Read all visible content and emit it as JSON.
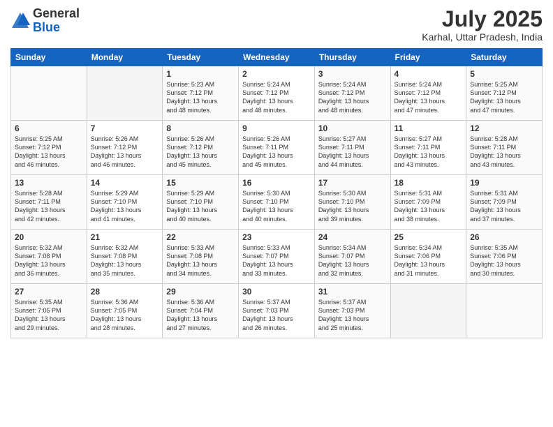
{
  "header": {
    "logo": {
      "general": "General",
      "blue": "Blue"
    },
    "title": "July 2025",
    "location": "Karhal, Uttar Pradesh, India"
  },
  "calendar": {
    "headers": [
      "Sunday",
      "Monday",
      "Tuesday",
      "Wednesday",
      "Thursday",
      "Friday",
      "Saturday"
    ],
    "weeks": [
      [
        {
          "day": "",
          "info": ""
        },
        {
          "day": "",
          "info": ""
        },
        {
          "day": "1",
          "info": "Sunrise: 5:23 AM\nSunset: 7:12 PM\nDaylight: 13 hours\nand 48 minutes."
        },
        {
          "day": "2",
          "info": "Sunrise: 5:24 AM\nSunset: 7:12 PM\nDaylight: 13 hours\nand 48 minutes."
        },
        {
          "day": "3",
          "info": "Sunrise: 5:24 AM\nSunset: 7:12 PM\nDaylight: 13 hours\nand 48 minutes."
        },
        {
          "day": "4",
          "info": "Sunrise: 5:24 AM\nSunset: 7:12 PM\nDaylight: 13 hours\nand 47 minutes."
        },
        {
          "day": "5",
          "info": "Sunrise: 5:25 AM\nSunset: 7:12 PM\nDaylight: 13 hours\nand 47 minutes."
        }
      ],
      [
        {
          "day": "6",
          "info": "Sunrise: 5:25 AM\nSunset: 7:12 PM\nDaylight: 13 hours\nand 46 minutes."
        },
        {
          "day": "7",
          "info": "Sunrise: 5:26 AM\nSunset: 7:12 PM\nDaylight: 13 hours\nand 46 minutes."
        },
        {
          "day": "8",
          "info": "Sunrise: 5:26 AM\nSunset: 7:12 PM\nDaylight: 13 hours\nand 45 minutes."
        },
        {
          "day": "9",
          "info": "Sunrise: 5:26 AM\nSunset: 7:11 PM\nDaylight: 13 hours\nand 45 minutes."
        },
        {
          "day": "10",
          "info": "Sunrise: 5:27 AM\nSunset: 7:11 PM\nDaylight: 13 hours\nand 44 minutes."
        },
        {
          "day": "11",
          "info": "Sunrise: 5:27 AM\nSunset: 7:11 PM\nDaylight: 13 hours\nand 43 minutes."
        },
        {
          "day": "12",
          "info": "Sunrise: 5:28 AM\nSunset: 7:11 PM\nDaylight: 13 hours\nand 43 minutes."
        }
      ],
      [
        {
          "day": "13",
          "info": "Sunrise: 5:28 AM\nSunset: 7:11 PM\nDaylight: 13 hours\nand 42 minutes."
        },
        {
          "day": "14",
          "info": "Sunrise: 5:29 AM\nSunset: 7:10 PM\nDaylight: 13 hours\nand 41 minutes."
        },
        {
          "day": "15",
          "info": "Sunrise: 5:29 AM\nSunset: 7:10 PM\nDaylight: 13 hours\nand 40 minutes."
        },
        {
          "day": "16",
          "info": "Sunrise: 5:30 AM\nSunset: 7:10 PM\nDaylight: 13 hours\nand 40 minutes."
        },
        {
          "day": "17",
          "info": "Sunrise: 5:30 AM\nSunset: 7:10 PM\nDaylight: 13 hours\nand 39 minutes."
        },
        {
          "day": "18",
          "info": "Sunrise: 5:31 AM\nSunset: 7:09 PM\nDaylight: 13 hours\nand 38 minutes."
        },
        {
          "day": "19",
          "info": "Sunrise: 5:31 AM\nSunset: 7:09 PM\nDaylight: 13 hours\nand 37 minutes."
        }
      ],
      [
        {
          "day": "20",
          "info": "Sunrise: 5:32 AM\nSunset: 7:08 PM\nDaylight: 13 hours\nand 36 minutes."
        },
        {
          "day": "21",
          "info": "Sunrise: 5:32 AM\nSunset: 7:08 PM\nDaylight: 13 hours\nand 35 minutes."
        },
        {
          "day": "22",
          "info": "Sunrise: 5:33 AM\nSunset: 7:08 PM\nDaylight: 13 hours\nand 34 minutes."
        },
        {
          "day": "23",
          "info": "Sunrise: 5:33 AM\nSunset: 7:07 PM\nDaylight: 13 hours\nand 33 minutes."
        },
        {
          "day": "24",
          "info": "Sunrise: 5:34 AM\nSunset: 7:07 PM\nDaylight: 13 hours\nand 32 minutes."
        },
        {
          "day": "25",
          "info": "Sunrise: 5:34 AM\nSunset: 7:06 PM\nDaylight: 13 hours\nand 31 minutes."
        },
        {
          "day": "26",
          "info": "Sunrise: 5:35 AM\nSunset: 7:06 PM\nDaylight: 13 hours\nand 30 minutes."
        }
      ],
      [
        {
          "day": "27",
          "info": "Sunrise: 5:35 AM\nSunset: 7:05 PM\nDaylight: 13 hours\nand 29 minutes."
        },
        {
          "day": "28",
          "info": "Sunrise: 5:36 AM\nSunset: 7:05 PM\nDaylight: 13 hours\nand 28 minutes."
        },
        {
          "day": "29",
          "info": "Sunrise: 5:36 AM\nSunset: 7:04 PM\nDaylight: 13 hours\nand 27 minutes."
        },
        {
          "day": "30",
          "info": "Sunrise: 5:37 AM\nSunset: 7:03 PM\nDaylight: 13 hours\nand 26 minutes."
        },
        {
          "day": "31",
          "info": "Sunrise: 5:37 AM\nSunset: 7:03 PM\nDaylight: 13 hours\nand 25 minutes."
        },
        {
          "day": "",
          "info": ""
        },
        {
          "day": "",
          "info": ""
        }
      ]
    ]
  }
}
